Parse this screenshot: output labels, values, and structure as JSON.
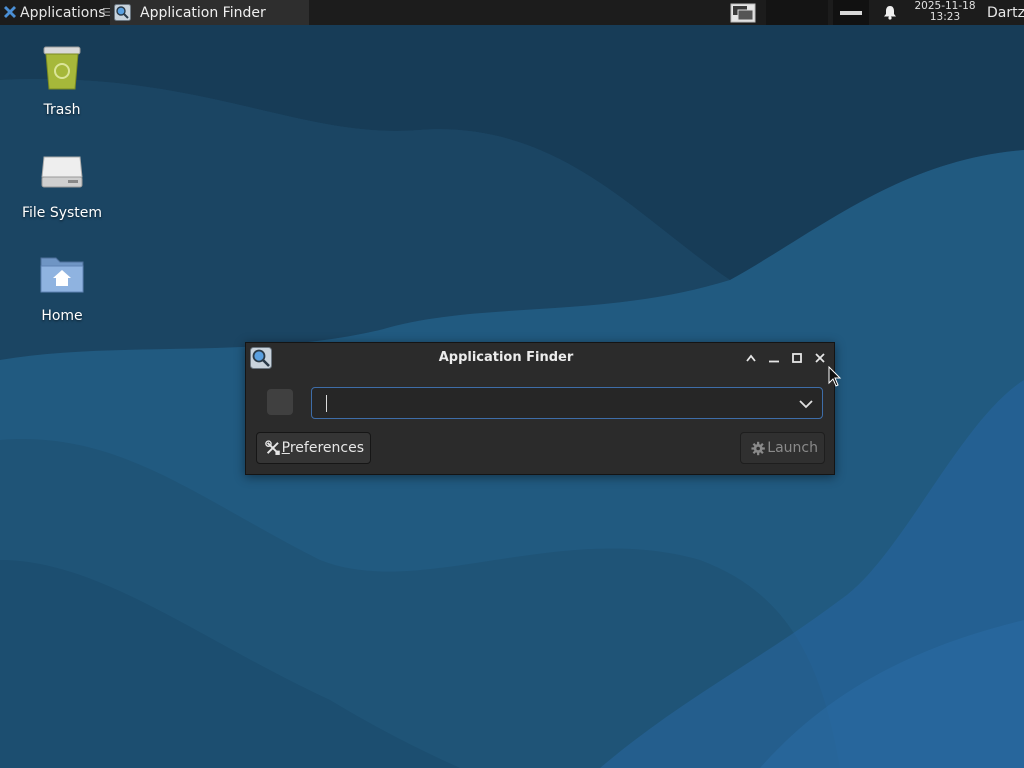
{
  "panel": {
    "applications_label": "Applications",
    "separator": "☰",
    "task_title": "Application Finder",
    "clock_date": "2025-11-18",
    "clock_time": "13:23",
    "user": "Dartz"
  },
  "desktop": {
    "icons": [
      {
        "label": "Trash"
      },
      {
        "label": "File System"
      },
      {
        "label": "Home"
      }
    ]
  },
  "window": {
    "title": "Application Finder",
    "search": {
      "value": "",
      "placeholder": ""
    },
    "preferences_label": "Preferences",
    "preferences_mnemonic": "P",
    "preferences_rest": "references",
    "launch_label": "Launch"
  },
  "colors": {
    "panel_bg": "#1c1c1c",
    "window_bg": "#2b2b2b",
    "focus_border": "#3e6da8",
    "desktop_base": "#1f4a68"
  }
}
